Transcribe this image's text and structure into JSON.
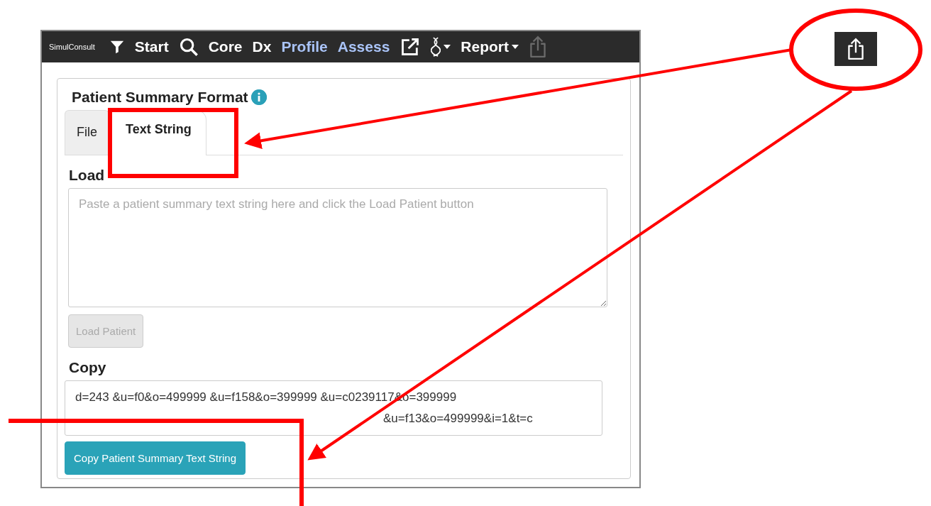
{
  "navbar": {
    "logo": "SimulConsult",
    "items": [
      {
        "kind": "filter"
      },
      {
        "kind": "text",
        "label": "Start",
        "highlighted": false
      },
      {
        "kind": "search"
      },
      {
        "kind": "text",
        "label": "Core",
        "highlighted": false
      },
      {
        "kind": "text",
        "label": "Dx",
        "highlighted": false
      },
      {
        "kind": "text",
        "label": "Profile",
        "highlighted": true
      },
      {
        "kind": "text",
        "label": "Assess",
        "highlighted": true
      },
      {
        "kind": "external"
      },
      {
        "kind": "dna",
        "dropdown": true
      },
      {
        "kind": "text",
        "label": "Report",
        "highlighted": false,
        "dropdown": true
      },
      {
        "kind": "share",
        "disabled": true
      }
    ]
  },
  "panel": {
    "title": "Patient Summary Format",
    "tabs": [
      {
        "label": "File",
        "selected": false
      },
      {
        "label": "Text String",
        "selected": true
      }
    ],
    "load_heading": "Load",
    "load_field": {
      "placeholder": "Paste a patient summary text string here and click the Load Patient button"
    },
    "load_button": {
      "label": "Load Patient",
      "disabled": true
    },
    "copy_heading": "Copy",
    "copy_field": {
      "value_lines": [
        "d=243 &u=f0&o=499999 &u=f158&o=399999 &u=c0239117&o=399999",
        "&u=f13&o=499999&i=1&t=c"
      ]
    },
    "copy_button": {
      "label": "Copy Patient Summary Text String",
      "disabled": false
    }
  }
}
